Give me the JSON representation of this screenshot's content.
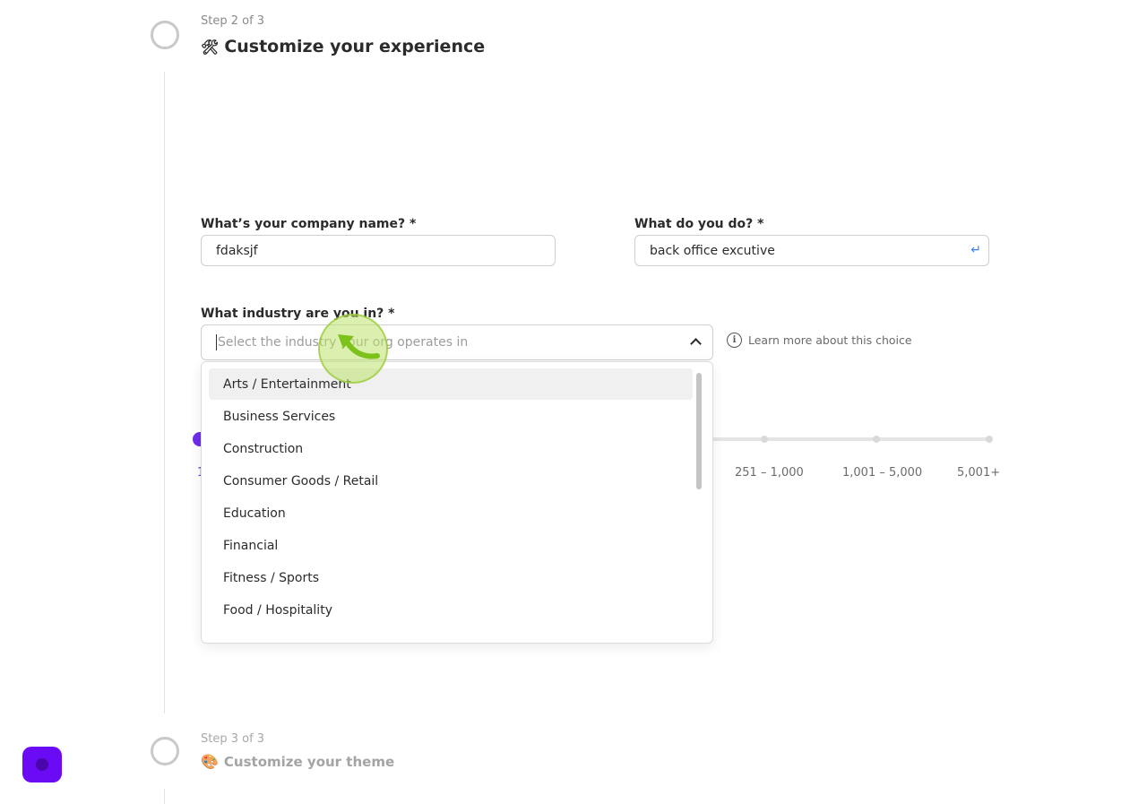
{
  "step2": {
    "label": "Step 2 of 3",
    "emoji": "🛠",
    "title": "Customize your experience"
  },
  "form": {
    "company_label": "What’s your company name? *",
    "company_value": "fdaksjf",
    "role_label": "What do you do? *",
    "role_value": "back office excutive",
    "industry_label": "What industry are you in? *",
    "industry_placeholder": "Select the industry your org operates in",
    "learn_more": "Learn more about this choice"
  },
  "industry_options": [
    "Arts / Entertainment",
    "Business Services",
    "Construction",
    "Consumer Goods / Retail",
    "Education",
    "Financial",
    "Fitness / Sports",
    "Food / Hospitality"
  ],
  "company_size": {
    "selected_label": "1",
    "ticks": [
      "251 – 1,000",
      "1,001 – 5,000",
      "5,001+"
    ]
  },
  "step3": {
    "label": "Step 3 of 3",
    "emoji": "🎨",
    "title": "Customize your theme"
  },
  "colors": {
    "accent": "#6e2cf0",
    "chat_launcher": "#6b0af5"
  }
}
